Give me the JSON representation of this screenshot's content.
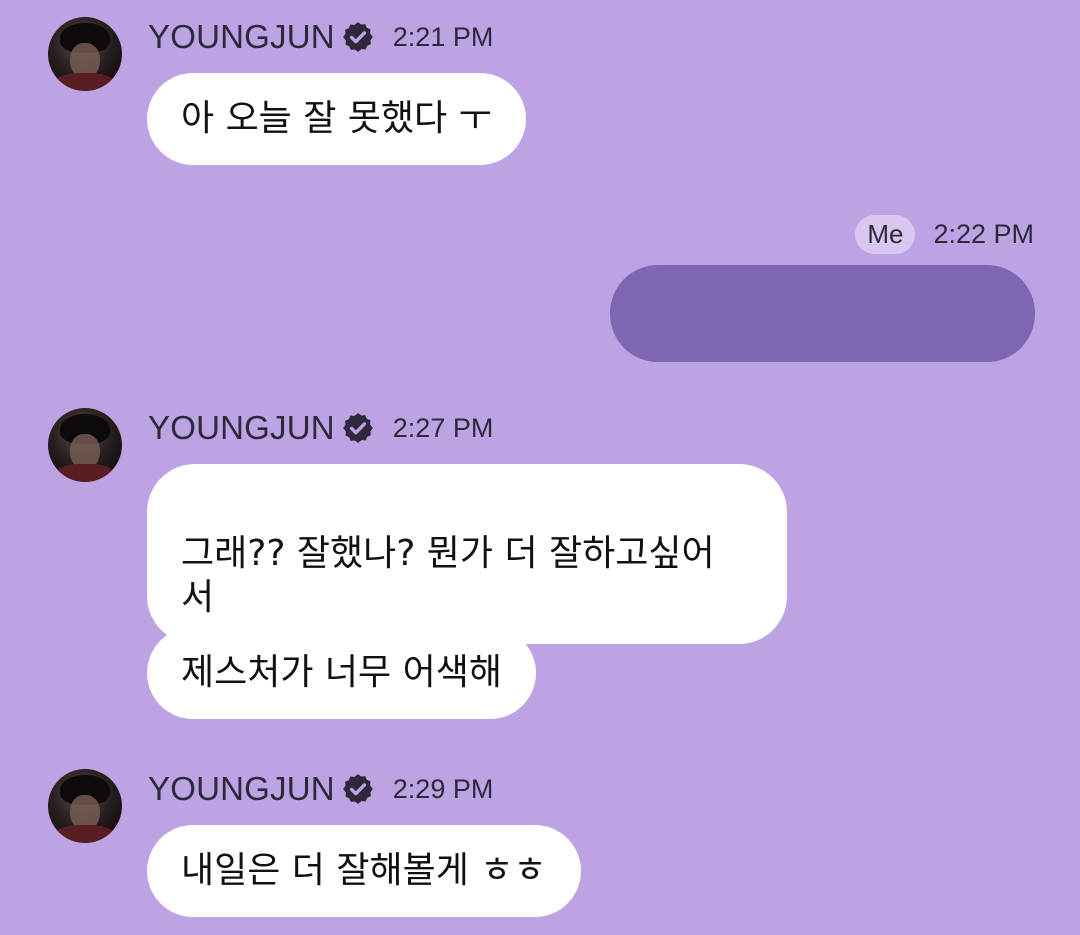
{
  "colors": {
    "background": "#bda2e4",
    "bubble_incoming": "#ffffff",
    "bubble_outgoing_hidden": "#7f66b4",
    "text_meta": "#2c2a3a"
  },
  "messages": [
    {
      "sender": "YOUNGJUN",
      "verified_icon": "verified-badge-icon",
      "time": "2:21 PM",
      "bubbles": [
        "아 오늘 잘 못했다 ㅜ"
      ]
    },
    {
      "sender_badge": "Me",
      "time": "2:22 PM"
    },
    {
      "sender": "YOUNGJUN",
      "verified_icon": "verified-badge-icon",
      "time": "2:27 PM",
      "bubbles": [
        "그래?? 잘했나? 뭔가 더 잘하고싶어\n서",
        "제스처가 너무 어색해"
      ]
    },
    {
      "sender": "YOUNGJUN",
      "verified_icon": "verified-badge-icon",
      "time": "2:29 PM",
      "bubbles": [
        "내일은 더 잘해볼게 ㅎㅎ"
      ]
    }
  ]
}
